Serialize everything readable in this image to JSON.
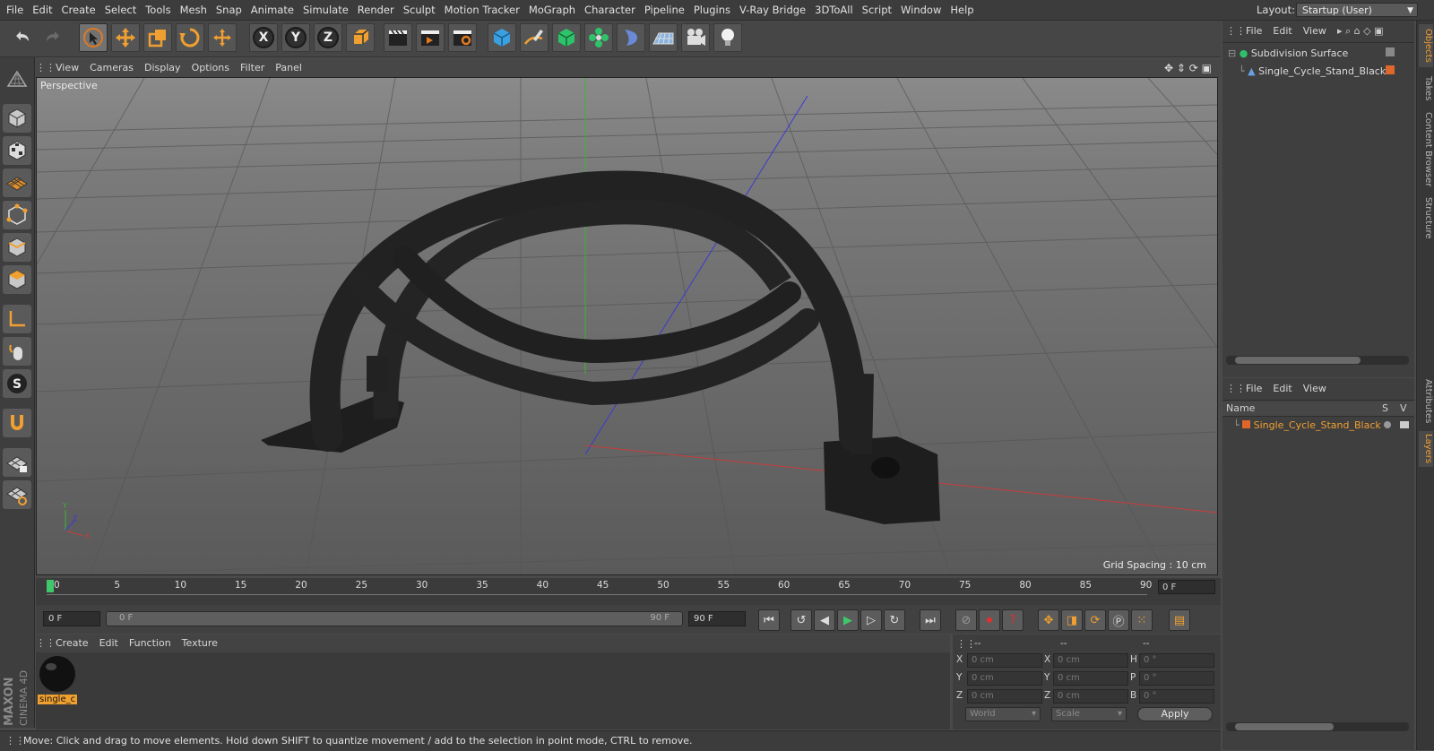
{
  "menubar": {
    "items": [
      "File",
      "Edit",
      "Create",
      "Select",
      "Tools",
      "Mesh",
      "Snap",
      "Animate",
      "Simulate",
      "Render",
      "Sculpt",
      "Motion Tracker",
      "MoGraph",
      "Character",
      "Pipeline",
      "Plugins",
      "V-Ray Bridge",
      "3DToAll",
      "Script",
      "Window",
      "Help"
    ],
    "layout_label": "Layout:",
    "layout_value": "Startup (User)"
  },
  "toolbar": {
    "axis_x": "X",
    "axis_y": "Y",
    "axis_z": "Z"
  },
  "viewport": {
    "menu": [
      "View",
      "Cameras",
      "Display",
      "Options",
      "Filter",
      "Panel"
    ],
    "label": "Perspective",
    "grid_spacing": "Grid Spacing : 10 cm"
  },
  "timeline": {
    "ticks": [
      "0",
      "5",
      "10",
      "15",
      "20",
      "25",
      "30",
      "35",
      "40",
      "45",
      "50",
      "55",
      "60",
      "65",
      "70",
      "75",
      "80",
      "85",
      "90"
    ],
    "current_frame": "0 F"
  },
  "transport": {
    "start_field": "0 F",
    "range_start": "0 F",
    "range_end": "90 F",
    "end_field": "90 F"
  },
  "material_manager": {
    "menu": [
      "Create",
      "Edit",
      "Function",
      "Texture"
    ],
    "material_name": "single_c"
  },
  "coordinates": {
    "header": [
      "--",
      "--",
      "--"
    ],
    "rows": [
      {
        "l1": "X",
        "v1": "0 cm",
        "l2": "X",
        "v2": "0 cm",
        "l3": "H",
        "v3": "0 °"
      },
      {
        "l1": "Y",
        "v1": "0 cm",
        "l2": "Y",
        "v2": "0 cm",
        "l3": "P",
        "v3": "0 °"
      },
      {
        "l1": "Z",
        "v1": "0 cm",
        "l2": "Z",
        "v2": "0 cm",
        "l3": "B",
        "v3": "0 °"
      }
    ],
    "mode1": "World",
    "mode2": "Scale",
    "apply": "Apply"
  },
  "status": {
    "text": "Move: Click and drag to move elements. Hold down SHIFT to quantize movement / add to the selection in point mode, CTRL to remove."
  },
  "object_manager": {
    "menu": [
      "File",
      "Edit",
      "View"
    ],
    "objects": [
      "Subdivision Surface",
      "Single_Cycle_Stand_Black"
    ]
  },
  "layer_manager": {
    "menu": [
      "File",
      "Edit",
      "View"
    ],
    "col_name": "Name",
    "col_s": "S",
    "col_v": "V",
    "layer": "Single_Cycle_Stand_Black"
  },
  "right_tabs": [
    "Objects",
    "Takes",
    "Content Browser",
    "Structure",
    "Attributes",
    "Layers"
  ],
  "brand": {
    "maxon": "MAXON",
    "product": "CINEMA 4D"
  },
  "colors": {
    "accent": "#f0a030",
    "layer_color": "#e0672a",
    "timeline_cursor": "#3ec86a"
  }
}
